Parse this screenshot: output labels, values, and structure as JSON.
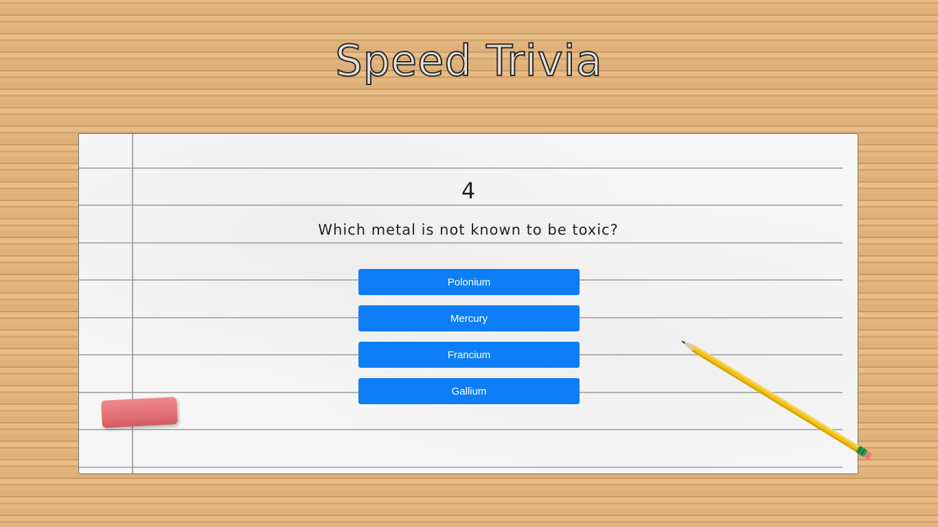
{
  "app": {
    "title": "Speed Trivia"
  },
  "quiz": {
    "countdown": "4",
    "question": "Which metal is not known to be toxic?",
    "answers": [
      "Polonium",
      "Mercury",
      "Francium",
      "Gallium"
    ]
  },
  "colors": {
    "button_bg": "#0d7ef5",
    "button_text": "#ffffff",
    "paper_bg": "#f6f6f6",
    "wood": "#d9a86f"
  },
  "decor": {
    "eraser": "eraser-icon",
    "pencil": "pencil-icon"
  }
}
